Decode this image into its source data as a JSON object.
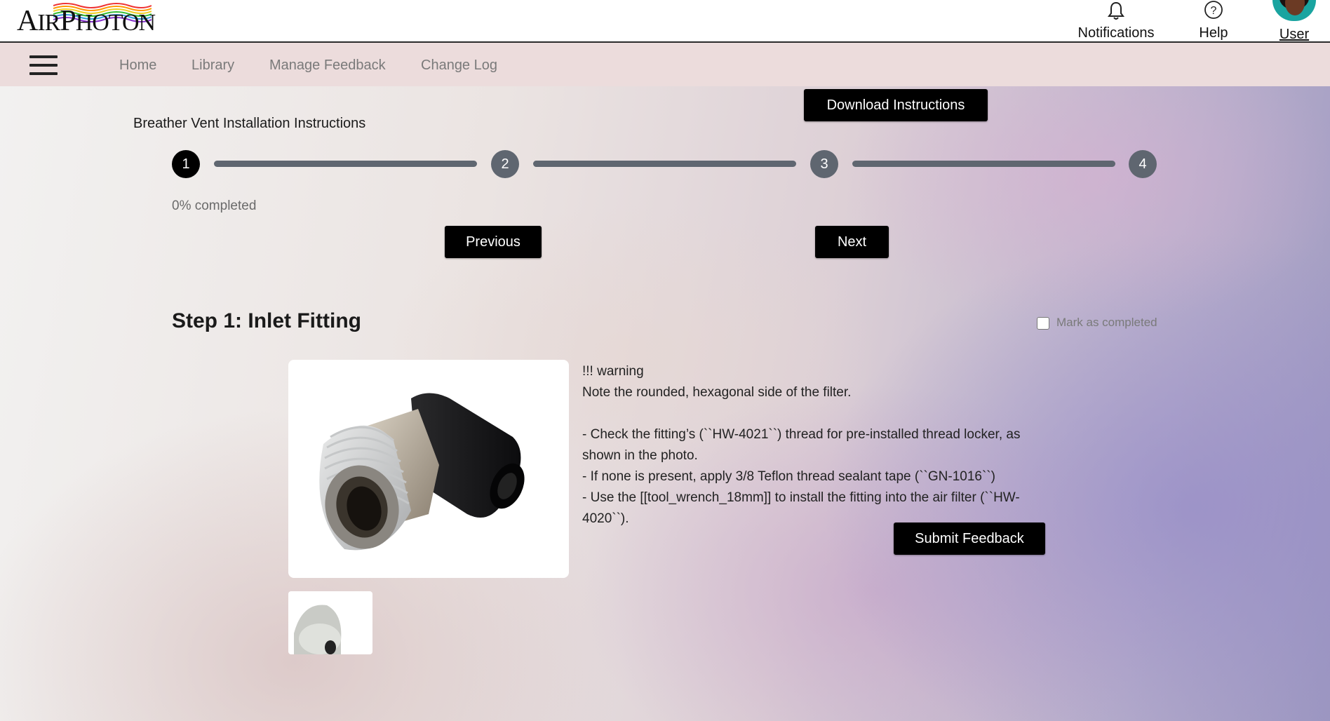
{
  "header": {
    "logo_text_a": "A",
    "logo_text_b": "IR",
    "logo_text_c": "P",
    "logo_text_d": "HOTON",
    "notifications_label": "Notifications",
    "help_label": "Help",
    "user_label": "User"
  },
  "nav": {
    "items": [
      {
        "label": "Home"
      },
      {
        "label": "Library"
      },
      {
        "label": "Manage Feedback"
      },
      {
        "label": "Change Log"
      }
    ]
  },
  "page": {
    "title": "Breather Vent Installation Instructions",
    "download_label": "Download Instructions",
    "steps": [
      {
        "number": "1",
        "active": true
      },
      {
        "number": "2",
        "active": false
      },
      {
        "number": "3",
        "active": false
      },
      {
        "number": "4",
        "active": false
      }
    ],
    "progress_percent": 0,
    "progress_text": "0% completed",
    "previous_label": "Previous",
    "next_label": "Next"
  },
  "step": {
    "heading": "Step 1: Inlet Fitting",
    "mark_completed_label": "Mark as completed",
    "mark_completed_checked": false,
    "lines": {
      "warning": "!!! warning",
      "note": "Note the rounded, hexagonal side of the filter.",
      "check": "- Check the fitting’s (``HW-4021``) thread for pre-installed thread locker, as shown in the photo.",
      "none": "- If none is present, apply 3/8 Teflon thread sealant tape (``GN-1016``)",
      "use": "- Use the [[tool_wrench_18mm]] to install the fitting into the air filter (``HW-4020``)."
    },
    "submit_feedback_label": "Submit Feedback"
  },
  "colors": {
    "button_bg": "#000000",
    "step_active": "#000000",
    "step_idle": "#5f6670",
    "nav_bg": "#ecdcdc"
  }
}
